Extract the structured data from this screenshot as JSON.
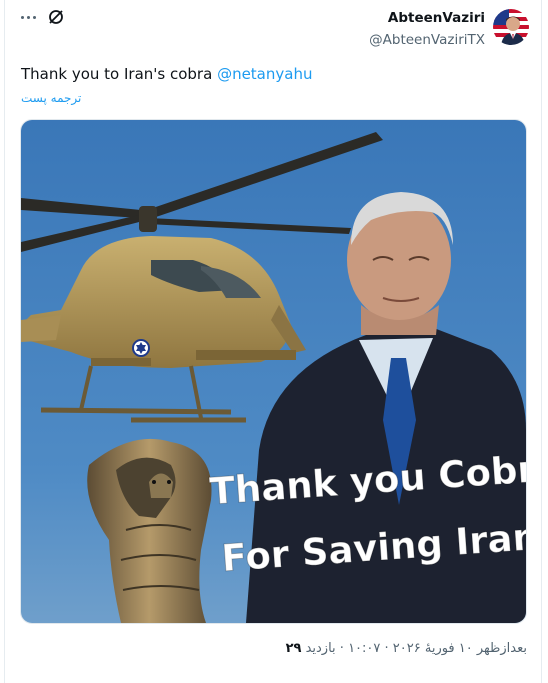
{
  "author": {
    "display_name": "AbteenVaziri",
    "handle": "@AbteenVaziriTX",
    "avatar_icon": "avatar-flag-portrait"
  },
  "tweet": {
    "text": "Thank you to Iran's cobra ",
    "mention": "@netanyahu",
    "translate_label": "ترجمه پست"
  },
  "media": {
    "overlay_line1": "Thank you Cobra",
    "overlay_line2": "For Saving Iran",
    "insignia_icon": "star-of-david-roundel-icon"
  },
  "footer": {
    "meta": "بعدازظهر ۱۰ فوریهٔ ۲۰۲۶ · ۱۰:۰۷ · بازدید ",
    "views": "۲۹"
  },
  "colors": {
    "link": "#1d9bf0",
    "secondary_text": "#536471",
    "sky": "#3a77b8",
    "helicopter": "#b39a5c"
  }
}
